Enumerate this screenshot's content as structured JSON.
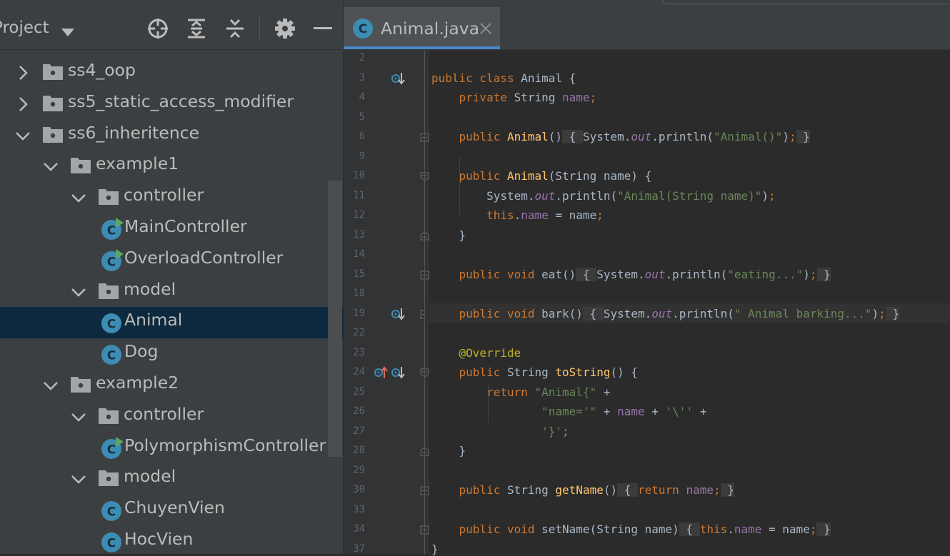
{
  "project_panel": {
    "title": "Project",
    "toolbar_icons": [
      "crosshair-icon",
      "expand-all-icon",
      "collapse-all-icon",
      "gear-icon",
      "minimize-icon"
    ],
    "tree": [
      {
        "label": "ss4_oop",
        "kind": "package",
        "expanded": false
      },
      {
        "label": "ss5_static_access_modifier",
        "kind": "package",
        "expanded": false
      },
      {
        "label": "ss6_inheritence",
        "kind": "package",
        "expanded": true
      },
      {
        "label": "example1",
        "kind": "package",
        "expanded": true
      },
      {
        "label": "controller",
        "kind": "package",
        "expanded": true
      },
      {
        "label": "MainController",
        "kind": "runnable-class"
      },
      {
        "label": "OverloadController",
        "kind": "runnable-class"
      },
      {
        "label": "model",
        "kind": "package",
        "expanded": true
      },
      {
        "label": "Animal",
        "kind": "class",
        "selected": true
      },
      {
        "label": "Dog",
        "kind": "class"
      },
      {
        "label": "example2",
        "kind": "package",
        "expanded": true
      },
      {
        "label": "controller",
        "kind": "package",
        "expanded": true
      },
      {
        "label": "PolymorphismController",
        "kind": "runnable-class"
      },
      {
        "label": "model",
        "kind": "package",
        "expanded": true
      },
      {
        "label": "ChuyenVien",
        "kind": "class"
      },
      {
        "label": "HocVien",
        "kind": "class"
      }
    ]
  },
  "editor": {
    "tab": {
      "label": "Animal.java",
      "icon": "class-icon"
    },
    "line_numbers": [
      "2",
      "3",
      "4",
      "5",
      "6",
      "9",
      "10",
      "11",
      "12",
      "13",
      "14",
      "15",
      "18",
      "19",
      "22",
      "23",
      "24",
      "25",
      "26",
      "27",
      "28",
      "29",
      "30",
      "33",
      "34",
      "37"
    ],
    "code_lines": [
      [],
      [
        [
          "k",
          "public class "
        ],
        [
          "p",
          "Animal {"
        ]
      ],
      [
        [
          "p",
          "    "
        ],
        [
          "k",
          "private "
        ],
        [
          "p",
          "String "
        ],
        [
          "f",
          "name"
        ],
        [
          "k",
          ";"
        ]
      ],
      [],
      [
        [
          "p",
          "    "
        ],
        [
          "k",
          "public "
        ],
        [
          "m",
          "Animal"
        ],
        [
          "p",
          "()"
        ],
        [
          "fb",
          " { "
        ],
        [
          "p",
          "System."
        ],
        [
          "fi",
          "out"
        ],
        [
          "p",
          ".println("
        ],
        [
          "s",
          "\"Animal()\""
        ],
        [
          "p",
          ")"
        ],
        [
          "k",
          ";"
        ],
        [
          "fb",
          " }"
        ]
      ],
      [],
      [
        [
          "p",
          "    "
        ],
        [
          "k",
          "public "
        ],
        [
          "m",
          "Animal"
        ],
        [
          "p",
          "(String name) {"
        ]
      ],
      [
        [
          "p",
          "        System."
        ],
        [
          "fi",
          "out"
        ],
        [
          "p",
          ".println("
        ],
        [
          "s",
          "\"Animal(String name)\""
        ],
        [
          "p",
          ")"
        ],
        [
          "k",
          ";"
        ]
      ],
      [
        [
          "p",
          "        "
        ],
        [
          "k",
          "this"
        ],
        [
          "p",
          "."
        ],
        [
          "f",
          "name"
        ],
        [
          "p",
          " = name"
        ],
        [
          "k",
          ";"
        ]
      ],
      [
        [
          "p",
          "    }"
        ]
      ],
      [],
      [
        [
          "p",
          "    "
        ],
        [
          "k",
          "public void "
        ],
        [
          "p",
          "eat()"
        ],
        [
          "fb",
          " { "
        ],
        [
          "p",
          "System."
        ],
        [
          "fi",
          "out"
        ],
        [
          "p",
          ".println("
        ],
        [
          "s",
          "\"eating...\""
        ],
        [
          "p",
          ")"
        ],
        [
          "k",
          ";"
        ],
        [
          "fb",
          " }"
        ]
      ],
      [],
      [
        [
          "p",
          "    "
        ],
        [
          "k",
          "public void "
        ],
        [
          "p",
          "bark()"
        ],
        [
          "fb",
          " { "
        ],
        [
          "p",
          "System."
        ],
        [
          "fi",
          "out"
        ],
        [
          "p",
          ".println("
        ],
        [
          "s",
          "\" Animal barking...\""
        ],
        [
          "p",
          ")"
        ],
        [
          "k",
          ";"
        ],
        [
          "fb",
          " }"
        ]
      ],
      [],
      [
        [
          "p",
          "    "
        ],
        [
          "a",
          "@Override"
        ]
      ],
      [
        [
          "p",
          "    "
        ],
        [
          "k",
          "public "
        ],
        [
          "p",
          "String "
        ],
        [
          "m",
          "toString"
        ],
        [
          "p",
          "() {"
        ]
      ],
      [
        [
          "p",
          "        "
        ],
        [
          "k",
          "return "
        ],
        [
          "s",
          "\"Animal{\""
        ],
        [
          "p",
          " +"
        ]
      ],
      [
        [
          "p",
          "                "
        ],
        [
          "s",
          "\"name='\""
        ],
        [
          "p",
          " + "
        ],
        [
          "f",
          "name"
        ],
        [
          "p",
          " + "
        ],
        [
          "s",
          "'\\''"
        ],
        [
          "p",
          " +"
        ]
      ],
      [
        [
          "p",
          "                "
        ],
        [
          "s",
          "'}'"
        ],
        [
          "k",
          ";"
        ]
      ],
      [
        [
          "p",
          "    }"
        ]
      ],
      [],
      [
        [
          "p",
          "    "
        ],
        [
          "k",
          "public "
        ],
        [
          "p",
          "String "
        ],
        [
          "m",
          "getName"
        ],
        [
          "p",
          "()"
        ],
        [
          "fb",
          " { "
        ],
        [
          "k",
          "return "
        ],
        [
          "f",
          "name"
        ],
        [
          "k",
          ";"
        ],
        [
          "fb",
          " }"
        ]
      ],
      [],
      [
        [
          "p",
          "    "
        ],
        [
          "k",
          "public void "
        ],
        [
          "p",
          "setName(String name)"
        ],
        [
          "fb",
          " { "
        ],
        [
          "k",
          "this"
        ],
        [
          "p",
          "."
        ],
        [
          "f",
          "name"
        ],
        [
          "p",
          " = name"
        ],
        [
          "k",
          ";"
        ],
        [
          "fb",
          " }"
        ]
      ],
      [
        [
          "p",
          "}"
        ]
      ]
    ],
    "gutter_markers": [
      {
        "line": "3",
        "icons": [
          "implemented-down-icon"
        ]
      },
      {
        "line": "19",
        "icons": [
          "implemented-down-icon"
        ]
      },
      {
        "line": "24",
        "icons": [
          "overrides-up-icon",
          "implemented-down-icon"
        ]
      }
    ]
  },
  "colors": {
    "keyword": "#cc7832",
    "string": "#6a8759",
    "field": "#9876aa",
    "method": "#ffc66d",
    "annotation": "#bbb529",
    "plain": "#a9b7c6",
    "selection": "#0d293e",
    "accent": "#4a88c7"
  }
}
